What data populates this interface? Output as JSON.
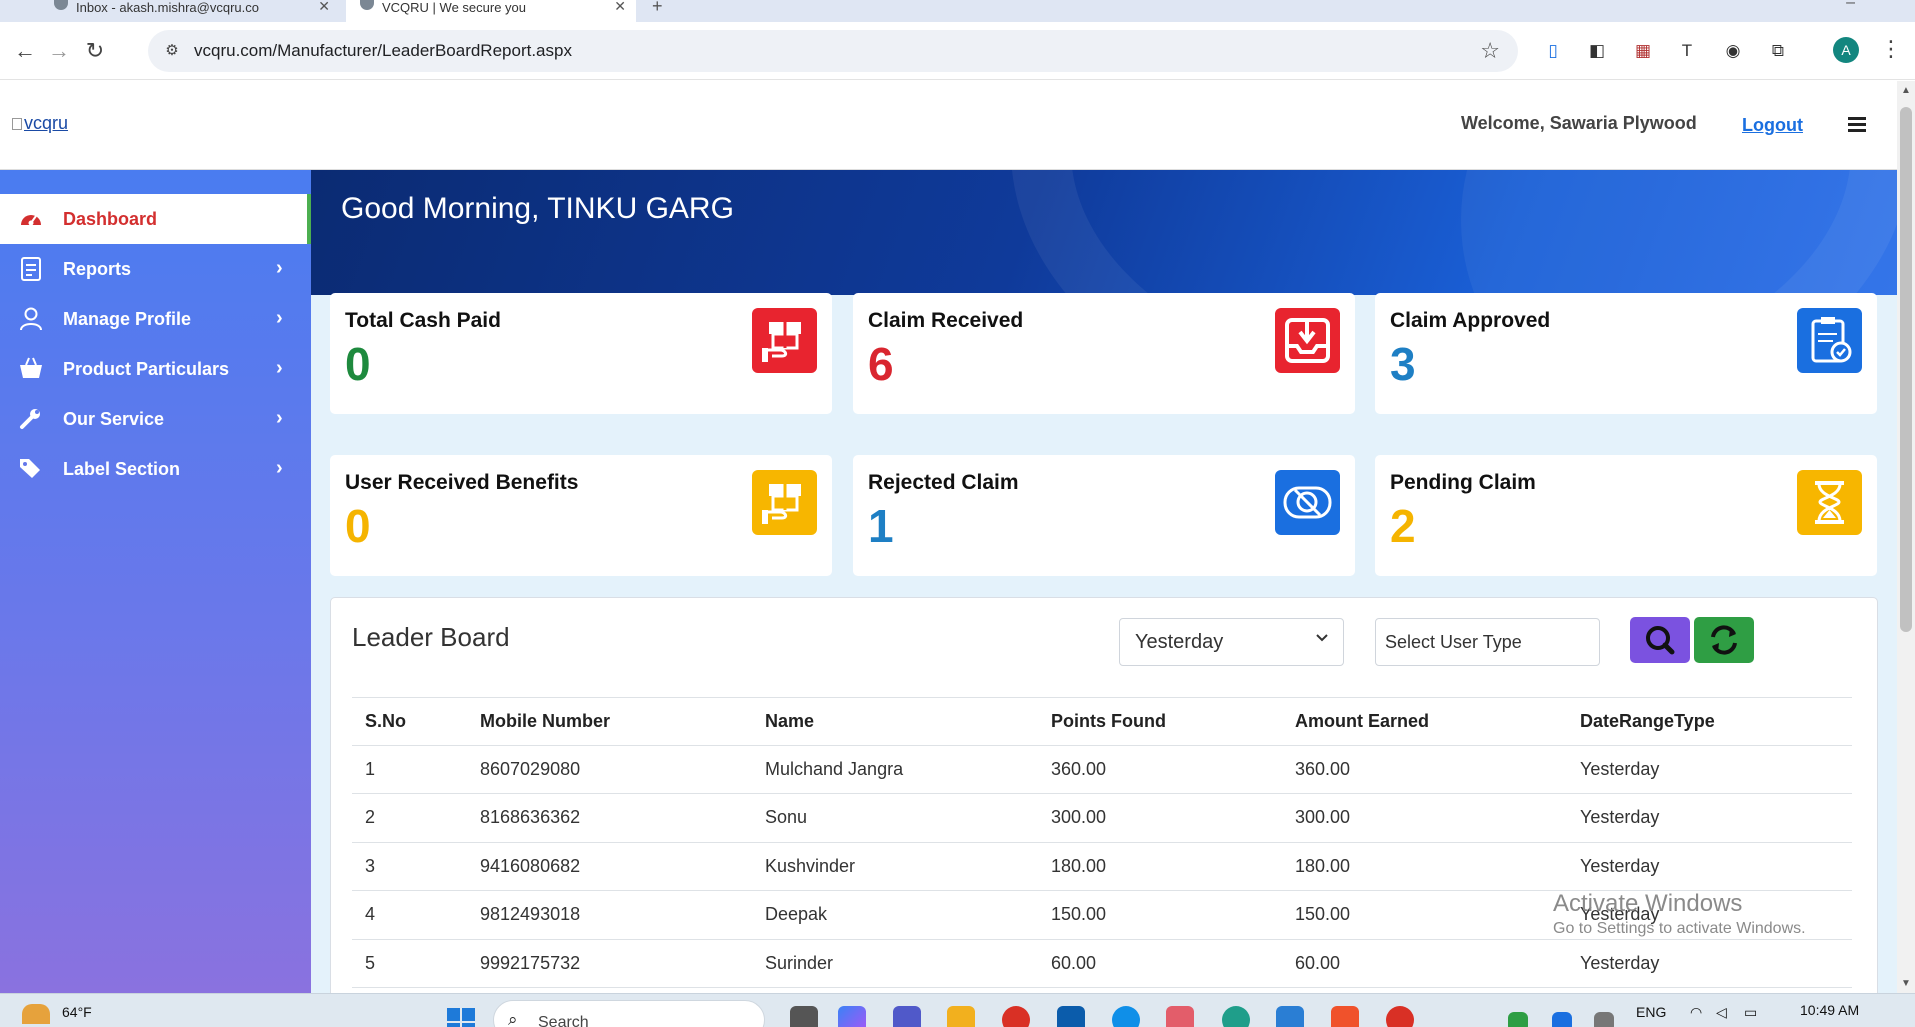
{
  "browser": {
    "tabs": [
      {
        "title": "Inbox - akash.mishra@vcqru.co"
      },
      {
        "title": "VCQRU | We secure you"
      }
    ],
    "url": "vcqru.com/Manufacturer/LeaderBoardReport.aspx",
    "profile_initial": "A"
  },
  "header": {
    "logo_alt": "vcqru",
    "welcome": "Welcome, Sawaria Plywood",
    "logout": "Logout"
  },
  "sidebar": {
    "items": [
      {
        "label": "Dashboard",
        "icon": "dashboard-gauge-icon"
      },
      {
        "label": "Reports",
        "icon": "report-document-icon"
      },
      {
        "label": "Manage Profile",
        "icon": "user-profile-icon"
      },
      {
        "label": "Product Particulars",
        "icon": "shopping-basket-icon"
      },
      {
        "label": "Our Service",
        "icon": "wrench-icon"
      },
      {
        "label": "Label Section",
        "icon": "tags-icon"
      }
    ]
  },
  "greeting": "Good Morning, TINKU GARG",
  "cards": [
    {
      "title": "Total Cash Paid",
      "value": "0",
      "color": "#1e8a3e",
      "icon": "cash-gift-icon",
      "icon_bg": "#e8242f"
    },
    {
      "title": "Claim Received",
      "value": "6",
      "color": "#d9262f",
      "icon": "inbox-download-icon",
      "icon_bg": "#e8242f"
    },
    {
      "title": "Claim Approved",
      "value": "3",
      "color": "#1e7fc4",
      "icon": "clipboard-check-icon",
      "icon_bg": "#1a6fe0"
    },
    {
      "title": "User Received Benefits",
      "value": "0",
      "color": "#f5b400",
      "icon": "benefit-gift-icon",
      "icon_bg": "#f7b600"
    },
    {
      "title": "Rejected Claim",
      "value": "1",
      "color": "#1e7fc4",
      "icon": "rejected-eye-slash-icon",
      "icon_bg": "#1a6fe0"
    },
    {
      "title": "Pending Claim",
      "value": "2",
      "color": "#f5b400",
      "icon": "hourglass-icon",
      "icon_bg": "#f7b600"
    }
  ],
  "leaderboard": {
    "title": "Leader Board",
    "date_filter": "Yesterday",
    "user_type_placeholder": "Select User Type",
    "columns": [
      "S.No",
      "Mobile Number",
      "Name",
      "Points Found",
      "Amount Earned",
      "DateRangeType"
    ],
    "rows": [
      [
        "1",
        "8607029080",
        "Mulchand Jangra",
        "360.00",
        "360.00",
        "Yesterday"
      ],
      [
        "2",
        "8168636362",
        "Sonu",
        "300.00",
        "300.00",
        "Yesterday"
      ],
      [
        "3",
        "9416080682",
        "Kushvinder",
        "180.00",
        "180.00",
        "Yesterday"
      ],
      [
        "4",
        "9812493018",
        "Deepak",
        "150.00",
        "150.00",
        "Yesterday"
      ],
      [
        "5",
        "9992175732",
        "Surinder",
        "60.00",
        "60.00",
        "Yesterday"
      ]
    ]
  },
  "watermark": {
    "line1": "Activate Windows",
    "line2": "Go to Settings to activate Windows."
  },
  "taskbar": {
    "temperature": "64°F",
    "search": "Search",
    "language": "ENG",
    "time": "10:49 AM"
  }
}
